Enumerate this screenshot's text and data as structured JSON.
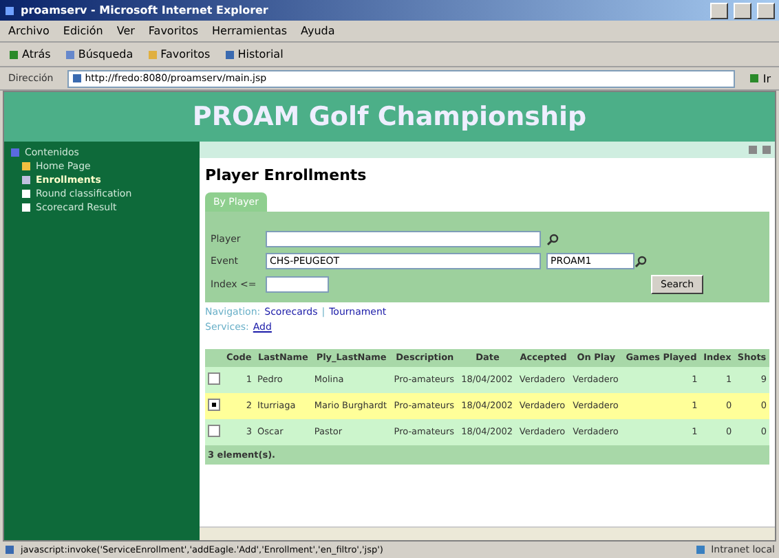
{
  "window": {
    "title": "proamserv - Microsoft Internet Explorer"
  },
  "menu": [
    "Archivo",
    "Edición",
    "Ver",
    "Favoritos",
    "Herramientas",
    "Ayuda"
  ],
  "toolbar": [
    "Atrás",
    "Búsqueda",
    "Favoritos",
    "Historial"
  ],
  "address": {
    "label": "Dirección",
    "value": "http://fredo:8080/proamserv/main.jsp",
    "go": "Ir"
  },
  "banner": {
    "title": "PROAM Golf Championship"
  },
  "sidebar": {
    "title": "Contenidos",
    "items": [
      {
        "label": "Home Page",
        "selected": false
      },
      {
        "label": "Enrollments",
        "selected": true
      },
      {
        "label": "Round classification",
        "selected": false
      },
      {
        "label": "Scorecard Result",
        "selected": false
      }
    ]
  },
  "page": {
    "heading": "Player Enrollments"
  },
  "tabs": [
    {
      "label": "By Player",
      "selected": true
    }
  ],
  "filter": {
    "player_label": "Player",
    "event_label": "Event",
    "event_value": "CHS-PEUGEOT",
    "event_code": "PROAM1",
    "index_label": "Index <=",
    "search": "Search"
  },
  "navigation": {
    "label": "Navigation:",
    "links": [
      "Scorecards",
      "Tournament"
    ],
    "separator": "|"
  },
  "services": {
    "label": "Services:",
    "links": [
      "Add"
    ]
  },
  "table": {
    "columns": [
      "Code",
      "LastName",
      "Ply_LastName",
      "Description",
      "Date",
      "Accepted",
      "On Play",
      "Games Played",
      "Index",
      "Shots"
    ],
    "rows": [
      {
        "selected": false,
        "cells": [
          "1",
          "Pedro",
          "Molina",
          "Pro-amateurs",
          "18/04/2002",
          "Verdadero",
          "Verdadero",
          "1",
          "1",
          "9"
        ]
      },
      {
        "selected": true,
        "cells": [
          "2",
          "Iturriaga",
          "Mario Burghardt",
          "Pro-amateurs",
          "18/04/2002",
          "Verdadero",
          "Verdadero",
          "1",
          "0",
          "0"
        ]
      },
      {
        "selected": false,
        "cells": [
          "3",
          "Oscar",
          "Pastor",
          "Pro-amateurs",
          "18/04/2002",
          "Verdadero",
          "Verdadero",
          "1",
          "0",
          "0"
        ]
      }
    ],
    "footer": "3 element(s)."
  },
  "status_bar": {
    "text": "javascript:invoke('ServiceEnrollment','addEagle.'Add','Enrollment','en_filtro','jsp')",
    "zone": "Intranet local"
  }
}
